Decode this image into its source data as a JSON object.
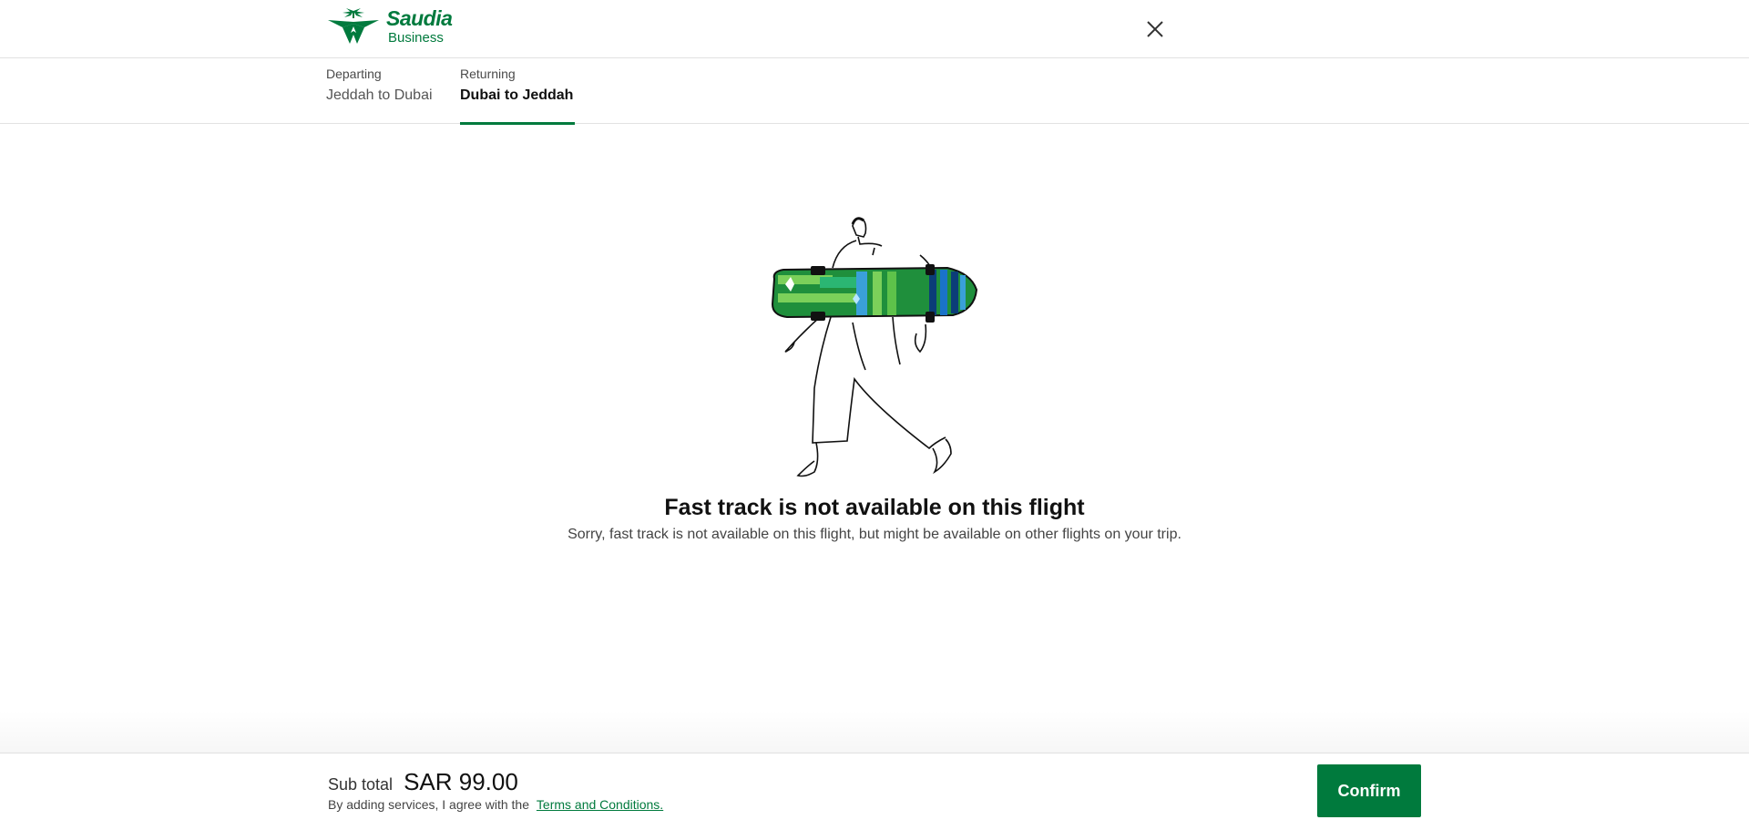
{
  "header": {
    "logo": {
      "brand": "Saudia",
      "sub": "Business",
      "color": "#007a3d"
    },
    "close_icon": "close-icon"
  },
  "tabs": [
    {
      "small": "Departing",
      "route": "Jeddah to Dubai",
      "active": false
    },
    {
      "small": "Returning",
      "route": "Dubai to Jeddah",
      "active": true
    }
  ],
  "empty_state": {
    "title": "Fast track is not available on this flight",
    "description": "Sorry, fast track is not available on this flight, but might be available on other flights on your trip."
  },
  "footer": {
    "subtotal_label": "Sub total",
    "subtotal_value": "SAR 99.00",
    "agree_text": "By adding services, I agree with the",
    "terms_link": "Terms and Conditions.",
    "confirm_label": "Confirm"
  },
  "colors": {
    "accent": "#007a3d"
  }
}
